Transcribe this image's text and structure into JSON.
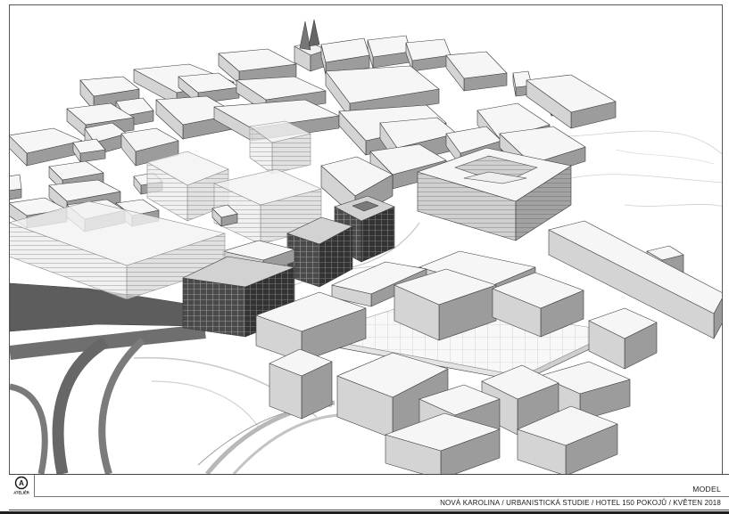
{
  "sheet": {
    "title": "MODEL",
    "subtitle": "NOVÁ KAROLINA / URBANISTICKÁ STUDIE / HOTEL 150 POKOJŮ / KVĚTEN 2018"
  },
  "logo": {
    "mark": "A",
    "text": "ATELIÉR",
    "icon": "atelier-logo-icon"
  },
  "colors": {
    "frame": "#444444",
    "roof": "#f6f6f6",
    "wall_light": "#d4d4d4",
    "wall_dark": "#9c9c9c",
    "hotel": "#3c3c3c",
    "road": "#5d5d5d",
    "bottom_bar": "#1e1e1e"
  }
}
